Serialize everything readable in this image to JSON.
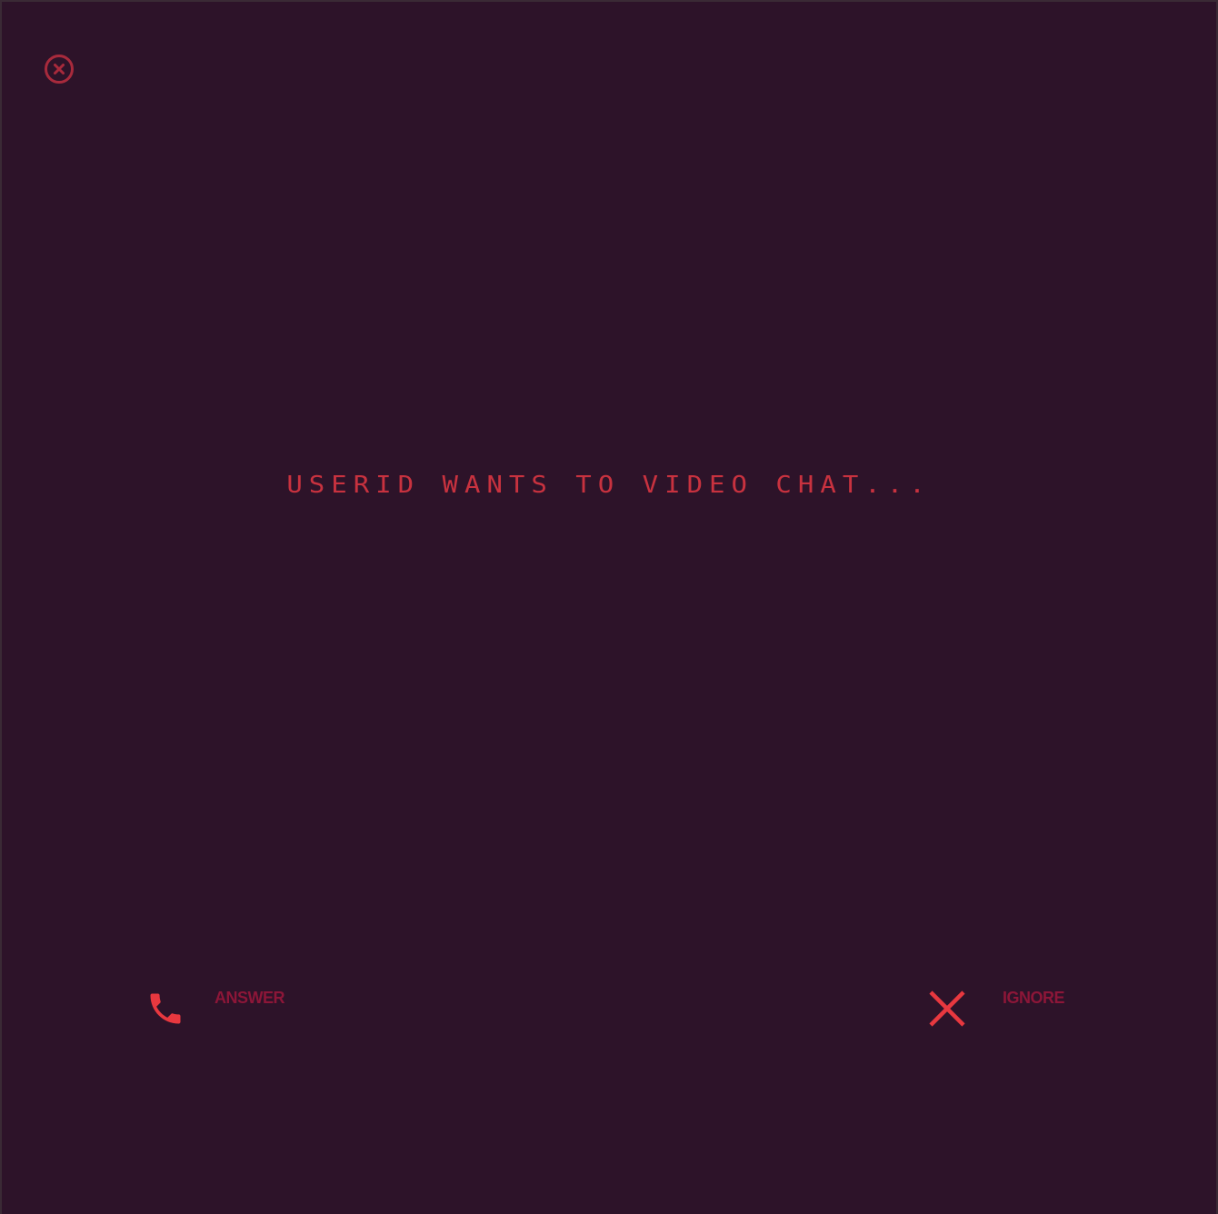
{
  "colors": {
    "background": "#2d1329",
    "accent": "#e8383f",
    "message_text": "#c8323f",
    "label_text": "#8c1638",
    "close_icon": "#a82a3c"
  },
  "header": {
    "close_icon": "close-circle-icon"
  },
  "call": {
    "message": "USERID WANTS TO VIDEO CHAT..."
  },
  "actions": {
    "answer": {
      "icon": "phone-icon",
      "label": "ANSWER"
    },
    "ignore": {
      "icon": "x-icon",
      "label": "IGNORE"
    }
  }
}
